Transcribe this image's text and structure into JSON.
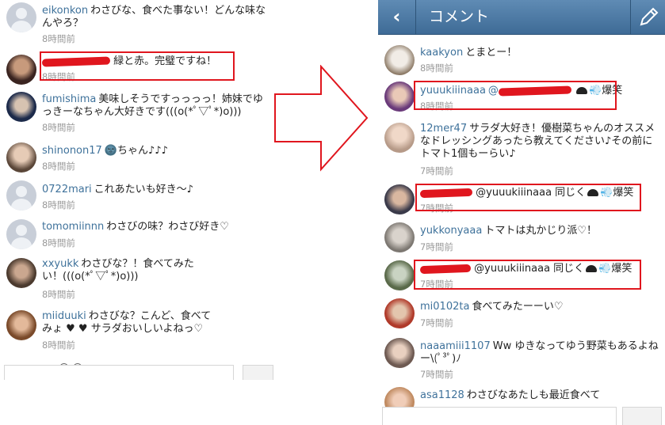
{
  "left_panel": {
    "comments": [
      {
        "user": "eikonkon",
        "text": "わさびな、食べた事ない！どんな味なんやろ？",
        "time": "8時間前"
      },
      {
        "user": "",
        "text": "緑と赤。完璧ですね！",
        "time": "8時間前"
      },
      {
        "user": "fumishima",
        "text": "美味しそうですっっっっ！姉妹でゆっきーなちゃん大好きです(((o(*ﾟ▽ﾟ*)o)))",
        "time": "8時間前"
      },
      {
        "user": "shinonon17",
        "text": "🌚ちゃん♪♪♪",
        "time": "8時間前"
      },
      {
        "user": "0722mari",
        "text": "これあたいも好き〜♪",
        "time": "8時間前"
      },
      {
        "user": "tomomiinnn",
        "text": "わさびの味？わさび好き♡",
        "time": "8時間前"
      },
      {
        "user": "xxyukk",
        "text": "わさびな？！食べてみたい！(((o(*ﾟ▽ﾟ*)o)))",
        "time": "8時間前"
      },
      {
        "user": "miiduuki",
        "text": "わさびな？こんど、食べてみょ ♥ ♥ サラダおいしいよねっ♡",
        "time": "8時間前"
      }
    ],
    "partial_text": "— — 〇 〇 · ·· · · · · · · · · · ·"
  },
  "right_panel": {
    "header": {
      "title": "コメント",
      "back_icon": "chevron-left-icon",
      "edit_icon": "pencil-icon"
    },
    "comments": [
      {
        "user": "kaakyon",
        "text": "とまとー！",
        "time": "8時間前"
      },
      {
        "user": "yuuukiiinaaa",
        "text": "@",
        "suffix": "爆笑",
        "time": "8時間前"
      },
      {
        "user": "12mer47",
        "text": "サラダ大好き！優樹菜ちゃんのオススメなドレッシングあったら教えてください♪その前にトマト1個もーらい♪",
        "time": "7時間前"
      },
      {
        "user": "",
        "text": "@yuuukiiinaaa 同じく",
        "suffix": "爆笑",
        "time": "7時間前"
      },
      {
        "user": "yukkonyaaa",
        "text": "トマトは丸かじり派♡！",
        "time": "7時間前"
      },
      {
        "user": "",
        "text": "@yuuukiiinaaa 同じく",
        "suffix": "爆笑",
        "time": "7時間前"
      },
      {
        "user": "mi0102ta",
        "text": "食べてみたーーい♡",
        "time": "7時間前"
      },
      {
        "user": "naaamiii1107",
        "text": "Ww ゆきなってゆう野菜もあるよねー\\(ﾟ³ﾟ)ﾉ",
        "time": "7時間前"
      },
      {
        "user": "asa1128",
        "text": "わさびなあたしも最近食べて",
        "time": ""
      }
    ]
  },
  "colors": {
    "username": "#3f729b",
    "timestamp": "#999999",
    "highlight": "#e0161e",
    "header": "#4f7ba6"
  }
}
